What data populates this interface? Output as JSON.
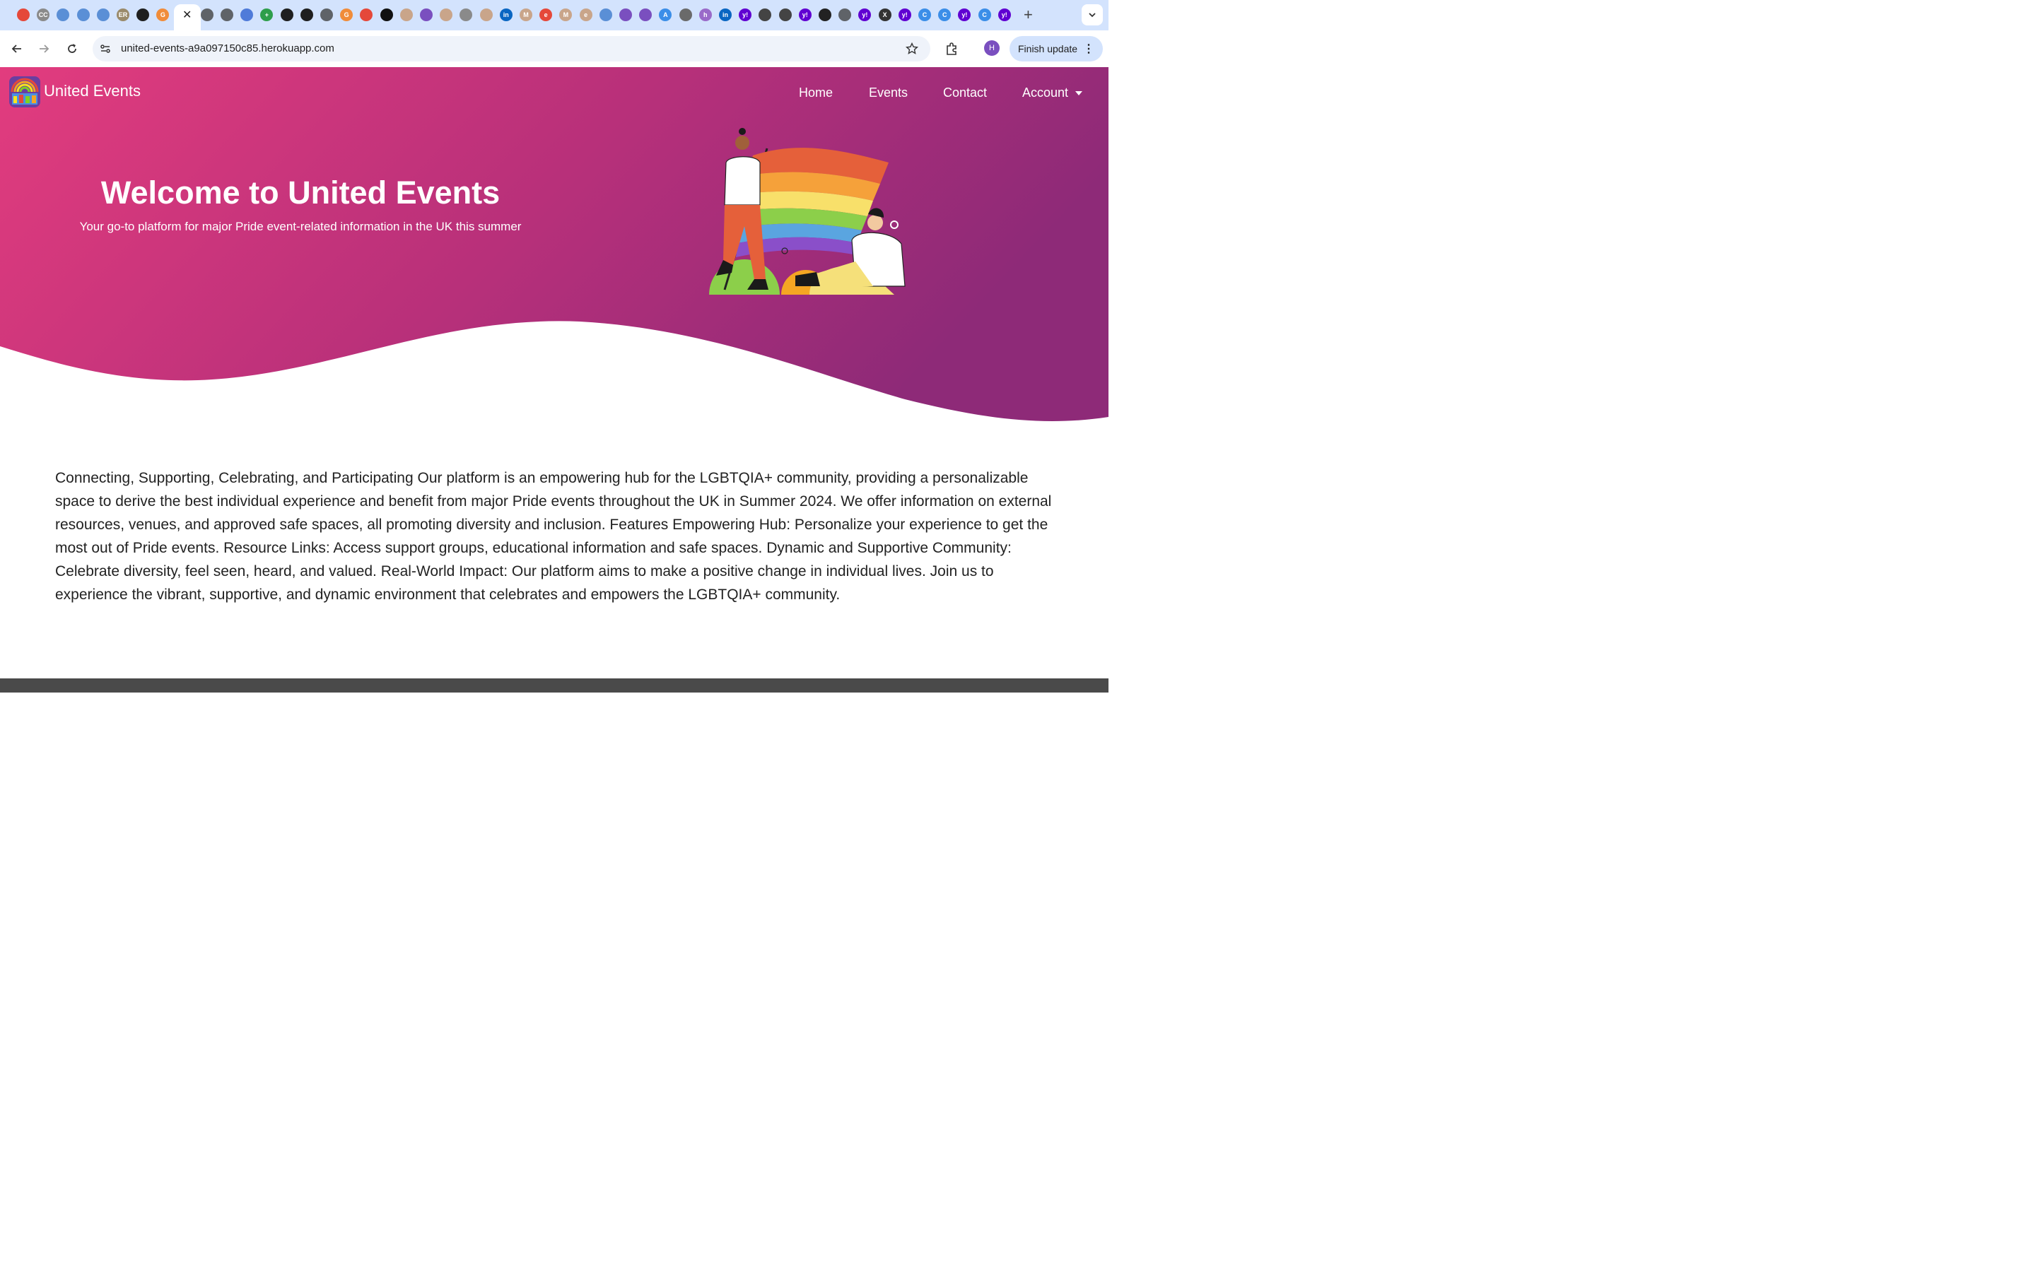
{
  "browser": {
    "url": "united-events-a9a097150c85.herokuapp.com",
    "finish_update_label": "Finish update",
    "profile_initial": "H",
    "tab_favicons": [
      {
        "icon": "opera-icon",
        "color": "#e5483a",
        "glyph": ""
      },
      {
        "icon": "cc-icon",
        "color": "#8a8a8a",
        "glyph": "CC"
      },
      {
        "icon": "globe-icon",
        "color": "#5a8fd6",
        "glyph": ""
      },
      {
        "icon": "globe-icon",
        "color": "#5a8fd6",
        "glyph": ""
      },
      {
        "icon": "globe-icon",
        "color": "#5a8fd6",
        "glyph": ""
      },
      {
        "icon": "er-icon",
        "color": "#9a8a6a",
        "glyph": "ER"
      },
      {
        "icon": "github-icon",
        "color": "#1f1f1f",
        "glyph": ""
      },
      {
        "icon": "g-icon",
        "color": "#f08c3a",
        "glyph": "G"
      },
      {
        "icon": "globe-icon",
        "color": "#5f6368",
        "glyph": ""
      },
      {
        "icon": "globe-icon",
        "color": "#5f6368",
        "glyph": ""
      },
      {
        "icon": "globe-icon",
        "color": "#5f6368",
        "glyph": ""
      },
      {
        "icon": "shield-icon",
        "color": "#4f7bd9",
        "glyph": ""
      },
      {
        "icon": "plus-icon",
        "color": "#2e9e4b",
        "glyph": "+"
      },
      {
        "icon": "github-icon",
        "color": "#1f1f1f",
        "glyph": ""
      },
      {
        "icon": "github-icon",
        "color": "#1f1f1f",
        "glyph": ""
      },
      {
        "icon": "globe-icon",
        "color": "#5f6368",
        "glyph": ""
      },
      {
        "icon": "g-icon",
        "color": "#f08c3a",
        "glyph": "G"
      },
      {
        "icon": "opera-icon",
        "color": "#e5483a",
        "glyph": ""
      },
      {
        "icon": "unsplash-icon",
        "color": "#111111",
        "glyph": ""
      },
      {
        "icon": "globe-icon",
        "color": "#c9a58a",
        "glyph": ""
      },
      {
        "icon": "globe-icon",
        "color": "#7a4fbf",
        "glyph": ""
      },
      {
        "icon": "globe-icon",
        "color": "#c9a58a",
        "glyph": ""
      },
      {
        "icon": "globe-icon",
        "color": "#8a8a8a",
        "glyph": ""
      },
      {
        "icon": "globe-icon",
        "color": "#c9a58a",
        "glyph": ""
      },
      {
        "icon": "linkedin-icon",
        "color": "#0a66c2",
        "glyph": "in"
      },
      {
        "icon": "gmail-icon",
        "color": "#c9a58a",
        "glyph": "M"
      },
      {
        "icon": "e-icon",
        "color": "#e5483a",
        "glyph": "e"
      },
      {
        "icon": "gmail-icon",
        "color": "#c9a58a",
        "glyph": "M"
      },
      {
        "icon": "e-icon",
        "color": "#c9a58a",
        "glyph": "e"
      },
      {
        "icon": "globe-icon",
        "color": "#5a8fd6",
        "glyph": ""
      },
      {
        "icon": "globe-icon",
        "color": "#7a4fbf",
        "glyph": ""
      },
      {
        "icon": "globe-icon",
        "color": "#7a4fbf",
        "glyph": ""
      },
      {
        "icon": "appstore-icon",
        "color": "#3b8ee8",
        "glyph": "A"
      },
      {
        "icon": "github-icon",
        "color": "#6a6a6a",
        "glyph": ""
      },
      {
        "icon": "h-icon",
        "color": "#9a6ac9",
        "glyph": "h"
      },
      {
        "icon": "linkedin-icon",
        "color": "#0a66c2",
        "glyph": "in"
      },
      {
        "icon": "yahoo-icon",
        "color": "#6001d2",
        "glyph": "y!"
      },
      {
        "icon": "globe-icon",
        "color": "#444444",
        "glyph": ""
      },
      {
        "icon": "openai-icon",
        "color": "#444444",
        "glyph": ""
      },
      {
        "icon": "yahoo-icon",
        "color": "#6001d2",
        "glyph": "y!"
      },
      {
        "icon": "globe-icon",
        "color": "#222222",
        "glyph": ""
      },
      {
        "icon": "globe-icon",
        "color": "#5f6368",
        "glyph": ""
      },
      {
        "icon": "yahoo-icon",
        "color": "#6001d2",
        "glyph": "y!"
      },
      {
        "icon": "x-icon",
        "color": "#333333",
        "glyph": "X"
      },
      {
        "icon": "yahoo-icon",
        "color": "#6001d2",
        "glyph": "y!"
      },
      {
        "icon": "c-icon",
        "color": "#3b8ee8",
        "glyph": "C"
      },
      {
        "icon": "c-icon",
        "color": "#3b8ee8",
        "glyph": "C"
      },
      {
        "icon": "yahoo-icon",
        "color": "#6001d2",
        "glyph": "y!"
      },
      {
        "icon": "c-icon",
        "color": "#3b8ee8",
        "glyph": "C"
      },
      {
        "icon": "yahoo-icon",
        "color": "#6001d2",
        "glyph": "y!"
      }
    ]
  },
  "site": {
    "brand": "United Events",
    "nav": {
      "home": "Home",
      "events": "Events",
      "contact": "Contact",
      "account": "Account"
    },
    "hero": {
      "title": "Welcome to United Events",
      "subtitle": "Your go-to platform for major Pride event-related information in the UK this summer"
    },
    "intro": "Connecting, Supporting, Celebrating, and Participating Our platform is an empowering hub for the LGBTQIA+ community, providing a personalizable space to derive the best individual experience and benefit from major Pride events throughout the UK in Summer 2024. We offer information on external resources, venues, and approved safe spaces, all promoting diversity and inclusion. Features Empowering Hub: Personalize your experience to get the most out of Pride events. Resource Links: Access support groups, educational information and safe spaces. Dynamic and Supportive Community: Celebrate diversity, feel seen, heard, and valued. Real-World Impact: Our platform aims to make a positive change in individual lives. Join us to experience the vibrant, supportive, and dynamic environment that celebrates and empowers the LGBTQIA+ community."
  },
  "colors": {
    "hero_start": "#e23c7e",
    "hero_end": "#8e2a78",
    "tabstrip": "#d3e3fd"
  }
}
